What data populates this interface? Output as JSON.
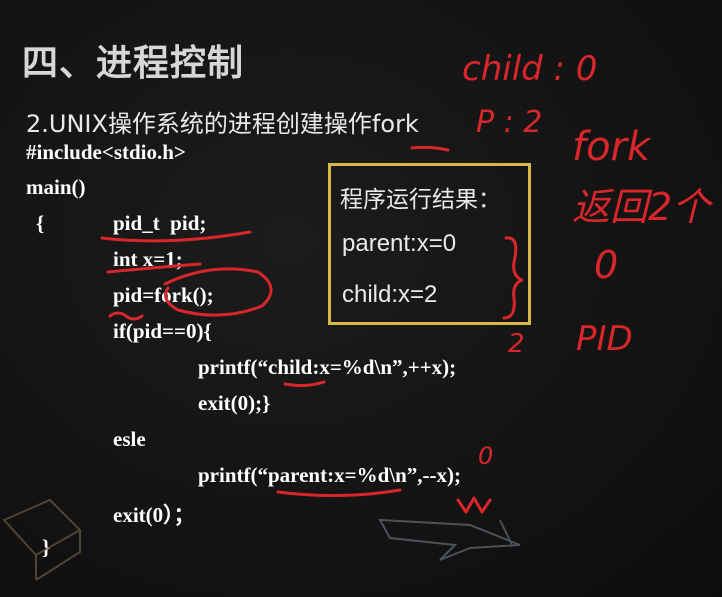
{
  "slide": {
    "title": "四、进程控制",
    "subtitle": "2.UNIX操作系统的进程创建操作fork"
  },
  "code_lines": [
    "#include<stdio.h>",
    "main()",
    "{",
    "pid_t  pid;",
    "int x=1;",
    "pid=fork();",
    "if(pid==0){",
    "printf(“child:x=%d\\n”,++x);",
    "exit(0);}",
    "esle",
    "printf(“parent:x=%d\\n”,--x);",
    "exit(0）；",
    "}"
  ],
  "result": {
    "title": "程序运行结果：",
    "lines": [
      "parent:x=0",
      "child:x=2"
    ]
  },
  "annotations": {
    "ink_color": "#d8262a",
    "handwritten": [
      "child : 0",
      "P : 2",
      "fork",
      "返回2个",
      "0",
      "PID",
      "2",
      "0"
    ]
  }
}
